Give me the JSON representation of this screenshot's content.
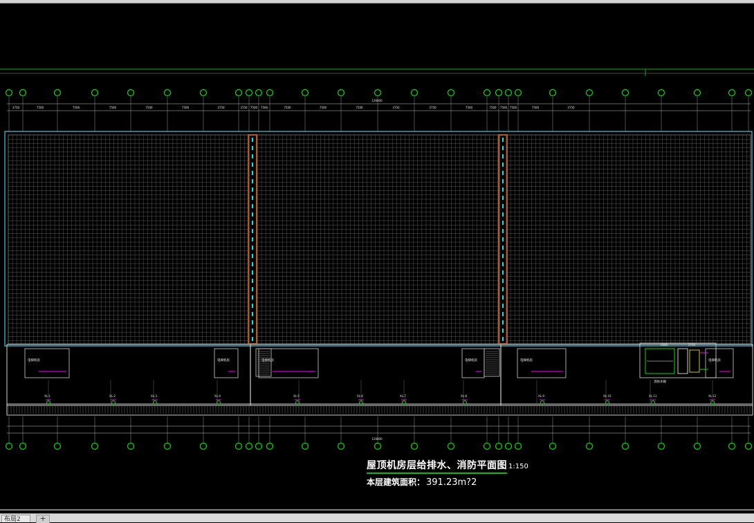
{
  "drawing": {
    "title": "屋顶机房层给排水、消防平面图",
    "scale": "1:150",
    "area_label": "本层建筑面积：",
    "area_value": "391.23m?2"
  },
  "layout_tab": {
    "label": "布局2"
  },
  "add_tab": {
    "label": "+"
  },
  "dimensions_top": [
    "3750",
    "7500",
    "7500",
    "7500",
    "7500",
    "7500",
    "3750",
    "3750",
    "7500",
    "7500",
    "7500",
    "7500",
    "7500",
    "3750",
    "3750",
    "7500",
    "7500",
    "7500",
    "7500",
    "7500",
    "3750"
  ],
  "dimension_total": "126600",
  "dimension_total_bottom": "126600",
  "room_labels": [
    "电梯机房",
    "电梯机房",
    "电梯机房",
    "电梯机房",
    "电梯机房",
    "电梯机房"
  ],
  "level_tags": [
    "XL-1",
    "XL-2",
    "XL-3",
    "XL-4",
    "XL-5",
    "XL-6",
    "XL-7",
    "XL-8",
    "XL-9",
    "XL-10",
    "XL-11",
    "XL-12",
    "XL-13"
  ],
  "detail_dims": [
    "6000",
    "2100"
  ],
  "detail_label": "消防水箱"
}
